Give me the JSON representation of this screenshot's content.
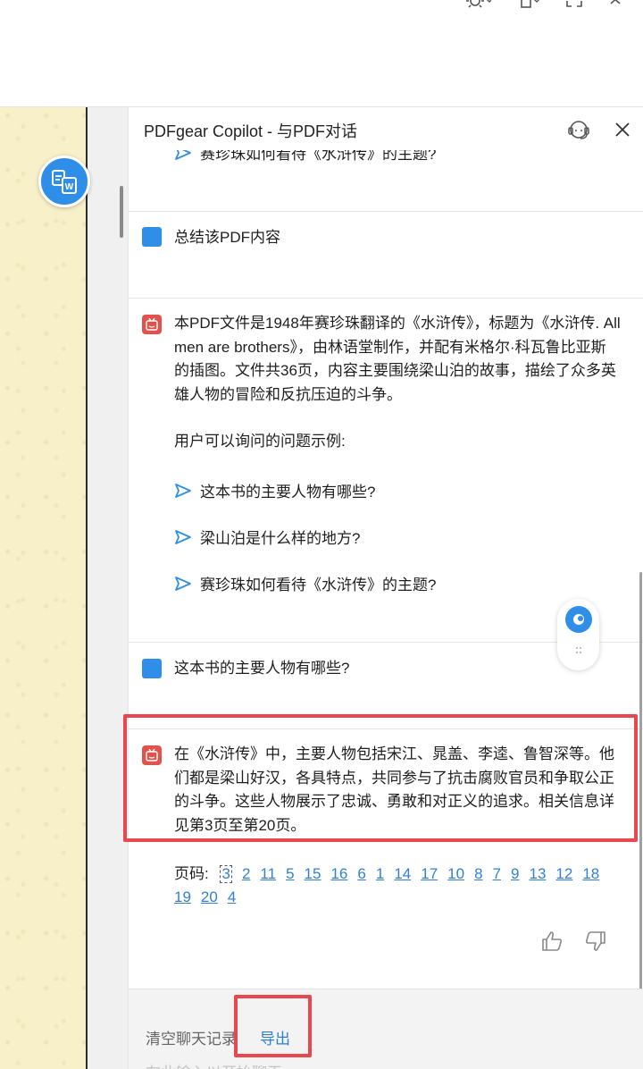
{
  "panel": {
    "title": "PDFgear Copilot - 与PDF对话"
  },
  "messages": {
    "top_cut_suggestion": "赛珍珠如何看待《水浒传》的主题?",
    "user_1": "总结该PDF内容",
    "ai_1": {
      "paragraph": "本PDF文件是1948年赛珍珠翻译的《水浒传》，标题为《水浒传. All men are brothers》，由林语堂制作，并配有米格尔·科瓦鲁比亚斯的插图。文件共36页，内容主要围绕梁山泊的故事，描绘了众多英雄人物的冒险和反抗压迫的斗争。",
      "examples_heading": "用户可以询问的问题示例:",
      "suggestions": [
        "这本书的主要人物有哪些?",
        "梁山泊是什么样的地方?",
        "赛珍珠如何看待《水浒传》的主题?"
      ]
    },
    "user_2": "这本书的主要人物有哪些?",
    "ai_2": {
      "paragraph": "在《水浒传》中，主要人物包括宋江、晁盖、李逵、鲁智深等。他们都是梁山好汉，各具特点，共同参与了抗击腐败官员和争取公正的斗争。这些人物展示了忠诚、勇敢和对正义的追求。相关信息详见第3页至第20页。",
      "pages_label": "页码:",
      "pages": [
        "3",
        "2",
        "11",
        "5",
        "15",
        "16",
        "6",
        "1",
        "14",
        "17",
        "10",
        "8",
        "7",
        "9",
        "13",
        "12",
        "18",
        "19",
        "20",
        "4"
      ]
    }
  },
  "bottom": {
    "clear_label": "清空聊天记录",
    "export_label": "导出",
    "input_placeholder": "在此输入以开始聊天"
  },
  "colors": {
    "accent": "#2f8fe8",
    "ai_avatar": "#e2524a",
    "highlight": "#e8474f",
    "link": "#2f7fd8",
    "page_background": "#f7f0c8"
  }
}
